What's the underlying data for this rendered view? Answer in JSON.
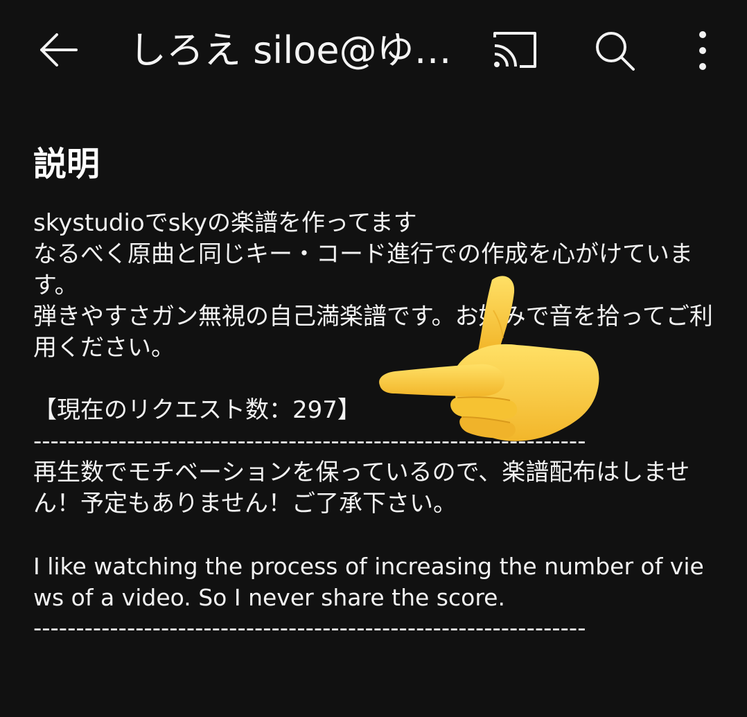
{
  "header": {
    "back_icon": "arrow-left-icon",
    "title": "しろえ siloe@ゆ…",
    "cast_icon": "cast-icon",
    "search_icon": "search-icon",
    "more_icon": "more-vertical-icon"
  },
  "description": {
    "heading": "説明",
    "line1": "skystudioでskyの楽譜を作ってます",
    "line2": "なるべく原曲と同じキー・コード進行での作成を心がけています。",
    "line3": "弾きやすさガン無視の自己満楽譜です。お好みで音を拾ってご利用ください。",
    "request_count": "【現在のリクエスト数：297】",
    "divider": "-----------------------------------------------------------------",
    "line4": "再生数でモチベーションを保っているので、楽譜配布はしません！予定もありません！ご了承下さい。",
    "english": "I like watching the process of increasing the number of views of a video. So I never share the score.",
    "divider2": "-----------------------------------------------------------------"
  },
  "overlay": {
    "sticker_icon": "pointing-hand-emoji-icon"
  },
  "colors": {
    "background": "#111111",
    "text": "#f2f2f2",
    "sticker": "#f5c431"
  }
}
